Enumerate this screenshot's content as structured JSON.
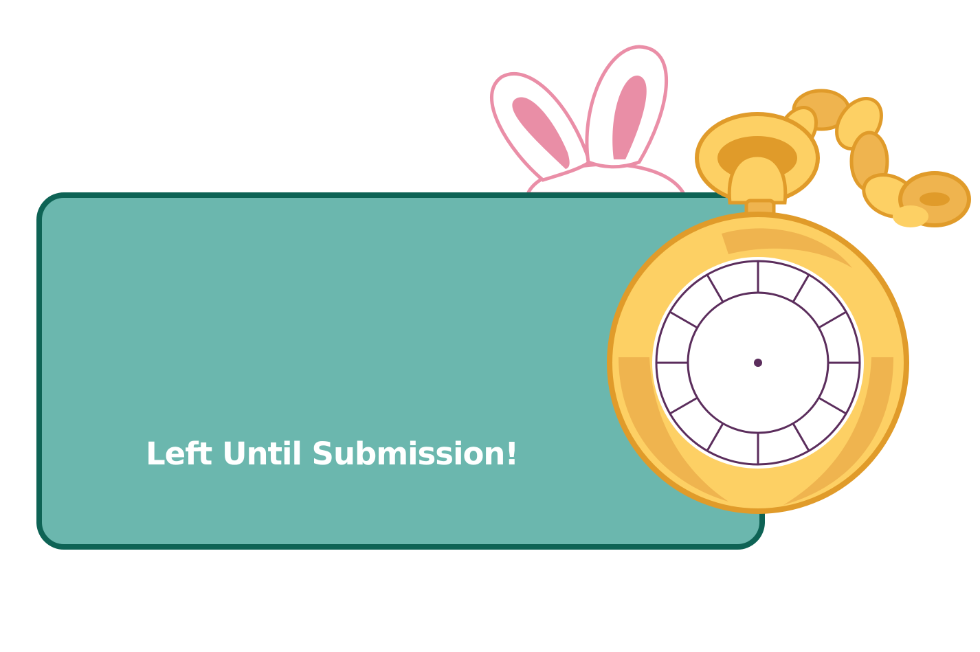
{
  "banner": {
    "text": "Left Until Submission!"
  },
  "colors": {
    "panel_fill": "#6bb7ae",
    "panel_border": "#0e6355",
    "ear_outline": "#ea8ea7",
    "ear_inner": "#e98ea6",
    "gold_light": "#fdd064",
    "gold_mid": "#efb44f",
    "gold_dark": "#e09b2a",
    "dial_ink": "#5b2d5c"
  },
  "icons": [
    "bunny-ears-icon",
    "pocket-watch-icon",
    "watch-chain-icon"
  ]
}
